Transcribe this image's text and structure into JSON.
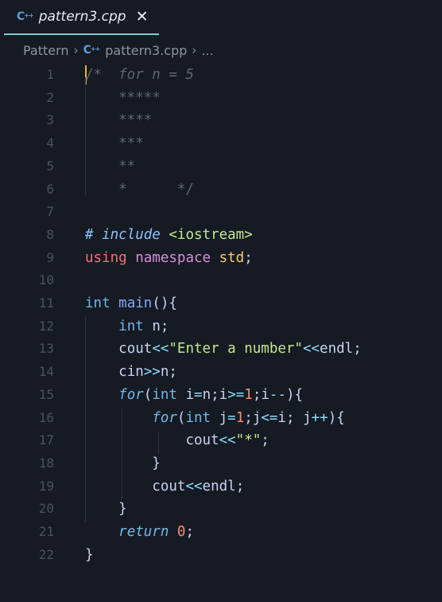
{
  "tab": {
    "icon": "cpp-icon",
    "title": "pattern3.cpp",
    "close": "✕"
  },
  "breadcrumb": {
    "folder": "Pattern",
    "file": "pattern3.cpp",
    "more": "..."
  },
  "editor": {
    "line_numbers": [
      "1",
      "2",
      "3",
      "4",
      "5",
      "6",
      "7",
      "8",
      "9",
      "10",
      "11",
      "12",
      "13",
      "14",
      "15",
      "16",
      "17",
      "18",
      "19",
      "20",
      "21",
      "22"
    ],
    "lines": [
      "/*  for n = 5",
      "    *****",
      "    ****",
      "    ***",
      "    **",
      "    *      */",
      "",
      "# include <iostream>",
      "using namespace std;",
      "",
      "int main(){",
      "    int n;",
      "    cout<<\"Enter a number\"<<endl;",
      "    cin>>n;",
      "    for(int i=n;i>=1;i--){",
      "        for(int j=1;j<=i; j++){",
      "            cout<<\"*\";",
      "        }",
      "        cout<<endl;",
      "    }",
      "    return 0;",
      "}"
    ]
  },
  "colors": {
    "background": "#161a22",
    "tab_underline": "#7ec7d6",
    "cursor": "#e5b33c"
  }
}
